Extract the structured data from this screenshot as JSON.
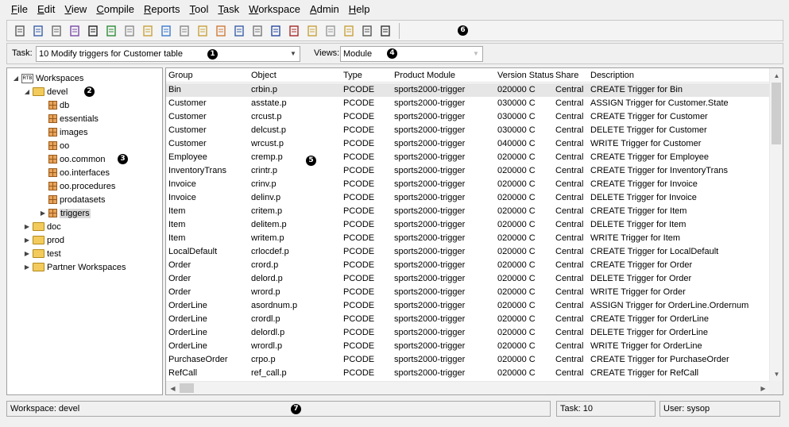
{
  "menu": [
    {
      "accel": "F",
      "rest": "ile"
    },
    {
      "accel": "E",
      "rest": "dit"
    },
    {
      "accel": "V",
      "rest": "iew"
    },
    {
      "accel": "C",
      "rest": "ompile"
    },
    {
      "accel": "R",
      "rest": "eports"
    },
    {
      "accel": "T",
      "rest": "ool",
      "pre": ""
    },
    {
      "accel": "T",
      "rest": "ask"
    },
    {
      "accel": "W",
      "rest": "orkspace"
    },
    {
      "accel": "A",
      "rest": "dmin"
    },
    {
      "accel": "H",
      "rest": "elp"
    }
  ],
  "toolbar": {
    "icons": [
      "brush-icon",
      "search-check-icon",
      "edit-icon",
      "search-object-icon",
      "binoculars-icon",
      "checkin-icon",
      "checkout-icon",
      "document-icon",
      "import-icon",
      "star-icon",
      "documents-icon",
      "grid-icon",
      "checklist-icon",
      "flask-icon",
      "tree-icon",
      "tree-alt-icon",
      "report-icon",
      "report-alt-icon",
      "notes-icon",
      "terminal-icon",
      "filter-icon"
    ],
    "badge": "6"
  },
  "task": {
    "label": "Task:",
    "value": "10 Modify triggers for Customer table",
    "badge": "1"
  },
  "views": {
    "label": "Views:",
    "value": "Module",
    "badge": "4"
  },
  "tree": {
    "root": {
      "label": "Workspaces",
      "icon_text": "RTB"
    },
    "devel": {
      "label": "devel",
      "badge": "2"
    },
    "modules": [
      "db",
      "essentials",
      "images",
      "oo",
      "oo.common",
      "oo.interfaces",
      "oo.procedures",
      "prodatasets",
      "triggers"
    ],
    "modules_badge": "3",
    "folders": [
      "doc",
      "prod",
      "test",
      "Partner Workspaces"
    ]
  },
  "grid": {
    "columns": [
      "Group",
      "Object",
      "Type",
      "Product Module",
      "Version Status",
      "Share",
      "Description"
    ],
    "badge": "5",
    "rows": [
      [
        "Bin",
        "crbin.p",
        "PCODE",
        "sports2000-trigger",
        "020000 C",
        "Central",
        "CREATE Trigger for Bin"
      ],
      [
        "Customer",
        "asstate.p",
        "PCODE",
        "sports2000-trigger",
        "030000 C",
        "Central",
        "ASSIGN Trigger for Customer.State"
      ],
      [
        "Customer",
        "crcust.p",
        "PCODE",
        "sports2000-trigger",
        "030000 C",
        "Central",
        "CREATE Trigger for Customer"
      ],
      [
        "Customer",
        "delcust.p",
        "PCODE",
        "sports2000-trigger",
        "030000 C",
        "Central",
        "DELETE Trigger for Customer"
      ],
      [
        "Customer",
        "wrcust.p",
        "PCODE",
        "sports2000-trigger",
        "040000 C",
        "Central",
        "WRITE Trigger for Customer"
      ],
      [
        "Employee",
        "cremp.p",
        "PCODE",
        "sports2000-trigger",
        "020000 C",
        "Central",
        "CREATE Trigger for Employee"
      ],
      [
        "InventoryTrans",
        "crintr.p",
        "PCODE",
        "sports2000-trigger",
        "020000 C",
        "Central",
        "CREATE Trigger for InventoryTrans"
      ],
      [
        "Invoice",
        "crinv.p",
        "PCODE",
        "sports2000-trigger",
        "020000 C",
        "Central",
        "CREATE Trigger for Invoice"
      ],
      [
        "Invoice",
        "delinv.p",
        "PCODE",
        "sports2000-trigger",
        "020000 C",
        "Central",
        "DELETE Trigger for Invoice"
      ],
      [
        "Item",
        "critem.p",
        "PCODE",
        "sports2000-trigger",
        "020000 C",
        "Central",
        "CREATE Trigger for Item"
      ],
      [
        "Item",
        "delitem.p",
        "PCODE",
        "sports2000-trigger",
        "020000 C",
        "Central",
        "DELETE Trigger for Item"
      ],
      [
        "Item",
        "writem.p",
        "PCODE",
        "sports2000-trigger",
        "020000 C",
        "Central",
        "WRITE Trigger for Item"
      ],
      [
        "LocalDefault",
        "crlocdef.p",
        "PCODE",
        "sports2000-trigger",
        "020000 C",
        "Central",
        "CREATE Trigger for LocalDefault"
      ],
      [
        "Order",
        "crord.p",
        "PCODE",
        "sports2000-trigger",
        "020000 C",
        "Central",
        "CREATE Trigger for Order"
      ],
      [
        "Order",
        "delord.p",
        "PCODE",
        "sports2000-trigger",
        "020000 C",
        "Central",
        "DELETE Trigger for Order"
      ],
      [
        "Order",
        "wrord.p",
        "PCODE",
        "sports2000-trigger",
        "020000 C",
        "Central",
        "WRITE Trigger for Order"
      ],
      [
        "OrderLine",
        "asordnum.p",
        "PCODE",
        "sports2000-trigger",
        "020000 C",
        "Central",
        "ASSIGN Trigger for OrderLine.Ordernum"
      ],
      [
        "OrderLine",
        "crordl.p",
        "PCODE",
        "sports2000-trigger",
        "020000 C",
        "Central",
        "CREATE Trigger for OrderLine"
      ],
      [
        "OrderLine",
        "delordl.p",
        "PCODE",
        "sports2000-trigger",
        "020000 C",
        "Central",
        "DELETE Trigger for OrderLine"
      ],
      [
        "OrderLine",
        "wrordl.p",
        "PCODE",
        "sports2000-trigger",
        "020000 C",
        "Central",
        "WRITE Trigger for OrderLine"
      ],
      [
        "PurchaseOrder",
        "crpo.p",
        "PCODE",
        "sports2000-trigger",
        "020000 C",
        "Central",
        "CREATE Trigger for PurchaseOrder"
      ],
      [
        "RefCall",
        "ref_call.p",
        "PCODE",
        "sports2000-trigger",
        "020000 C",
        "Central",
        "CREATE Trigger for RefCall"
      ]
    ]
  },
  "status": {
    "workspace": "Workspace: devel",
    "task": "Task: 10",
    "user": "User: sysop",
    "badge": "7"
  },
  "colors": {
    "selected_row": "#e6e6e6",
    "badge": "#000000",
    "folder": "#f2cb5c"
  }
}
